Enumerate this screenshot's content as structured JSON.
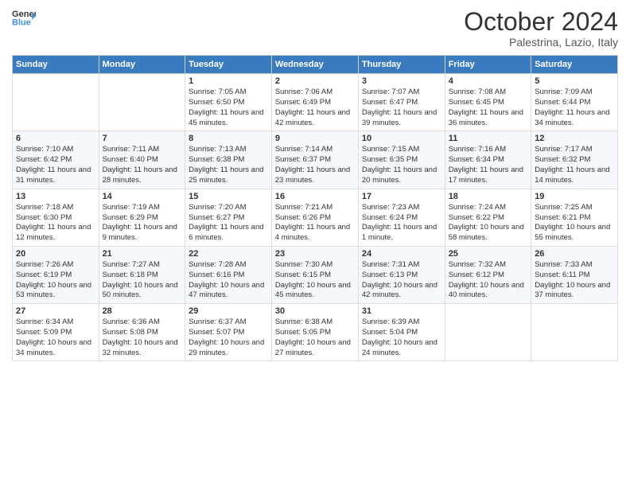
{
  "header": {
    "logo_line1": "General",
    "logo_line2": "Blue",
    "month": "October 2024",
    "location": "Palestrina, Lazio, Italy"
  },
  "weekdays": [
    "Sunday",
    "Monday",
    "Tuesday",
    "Wednesday",
    "Thursday",
    "Friday",
    "Saturday"
  ],
  "weeks": [
    [
      {
        "day": "",
        "sunrise": "",
        "sunset": "",
        "daylight": ""
      },
      {
        "day": "",
        "sunrise": "",
        "sunset": "",
        "daylight": ""
      },
      {
        "day": "1",
        "sunrise": "Sunrise: 7:05 AM",
        "sunset": "Sunset: 6:50 PM",
        "daylight": "Daylight: 11 hours and 45 minutes."
      },
      {
        "day": "2",
        "sunrise": "Sunrise: 7:06 AM",
        "sunset": "Sunset: 6:49 PM",
        "daylight": "Daylight: 11 hours and 42 minutes."
      },
      {
        "day": "3",
        "sunrise": "Sunrise: 7:07 AM",
        "sunset": "Sunset: 6:47 PM",
        "daylight": "Daylight: 11 hours and 39 minutes."
      },
      {
        "day": "4",
        "sunrise": "Sunrise: 7:08 AM",
        "sunset": "Sunset: 6:45 PM",
        "daylight": "Daylight: 11 hours and 36 minutes."
      },
      {
        "day": "5",
        "sunrise": "Sunrise: 7:09 AM",
        "sunset": "Sunset: 6:44 PM",
        "daylight": "Daylight: 11 hours and 34 minutes."
      }
    ],
    [
      {
        "day": "6",
        "sunrise": "Sunrise: 7:10 AM",
        "sunset": "Sunset: 6:42 PM",
        "daylight": "Daylight: 11 hours and 31 minutes."
      },
      {
        "day": "7",
        "sunrise": "Sunrise: 7:11 AM",
        "sunset": "Sunset: 6:40 PM",
        "daylight": "Daylight: 11 hours and 28 minutes."
      },
      {
        "day": "8",
        "sunrise": "Sunrise: 7:13 AM",
        "sunset": "Sunset: 6:38 PM",
        "daylight": "Daylight: 11 hours and 25 minutes."
      },
      {
        "day": "9",
        "sunrise": "Sunrise: 7:14 AM",
        "sunset": "Sunset: 6:37 PM",
        "daylight": "Daylight: 11 hours and 23 minutes."
      },
      {
        "day": "10",
        "sunrise": "Sunrise: 7:15 AM",
        "sunset": "Sunset: 6:35 PM",
        "daylight": "Daylight: 11 hours and 20 minutes."
      },
      {
        "day": "11",
        "sunrise": "Sunrise: 7:16 AM",
        "sunset": "Sunset: 6:34 PM",
        "daylight": "Daylight: 11 hours and 17 minutes."
      },
      {
        "day": "12",
        "sunrise": "Sunrise: 7:17 AM",
        "sunset": "Sunset: 6:32 PM",
        "daylight": "Daylight: 11 hours and 14 minutes."
      }
    ],
    [
      {
        "day": "13",
        "sunrise": "Sunrise: 7:18 AM",
        "sunset": "Sunset: 6:30 PM",
        "daylight": "Daylight: 11 hours and 12 minutes."
      },
      {
        "day": "14",
        "sunrise": "Sunrise: 7:19 AM",
        "sunset": "Sunset: 6:29 PM",
        "daylight": "Daylight: 11 hours and 9 minutes."
      },
      {
        "day": "15",
        "sunrise": "Sunrise: 7:20 AM",
        "sunset": "Sunset: 6:27 PM",
        "daylight": "Daylight: 11 hours and 6 minutes."
      },
      {
        "day": "16",
        "sunrise": "Sunrise: 7:21 AM",
        "sunset": "Sunset: 6:26 PM",
        "daylight": "Daylight: 11 hours and 4 minutes."
      },
      {
        "day": "17",
        "sunrise": "Sunrise: 7:23 AM",
        "sunset": "Sunset: 6:24 PM",
        "daylight": "Daylight: 11 hours and 1 minute."
      },
      {
        "day": "18",
        "sunrise": "Sunrise: 7:24 AM",
        "sunset": "Sunset: 6:22 PM",
        "daylight": "Daylight: 10 hours and 58 minutes."
      },
      {
        "day": "19",
        "sunrise": "Sunrise: 7:25 AM",
        "sunset": "Sunset: 6:21 PM",
        "daylight": "Daylight: 10 hours and 55 minutes."
      }
    ],
    [
      {
        "day": "20",
        "sunrise": "Sunrise: 7:26 AM",
        "sunset": "Sunset: 6:19 PM",
        "daylight": "Daylight: 10 hours and 53 minutes."
      },
      {
        "day": "21",
        "sunrise": "Sunrise: 7:27 AM",
        "sunset": "Sunset: 6:18 PM",
        "daylight": "Daylight: 10 hours and 50 minutes."
      },
      {
        "day": "22",
        "sunrise": "Sunrise: 7:28 AM",
        "sunset": "Sunset: 6:16 PM",
        "daylight": "Daylight: 10 hours and 47 minutes."
      },
      {
        "day": "23",
        "sunrise": "Sunrise: 7:30 AM",
        "sunset": "Sunset: 6:15 PM",
        "daylight": "Daylight: 10 hours and 45 minutes."
      },
      {
        "day": "24",
        "sunrise": "Sunrise: 7:31 AM",
        "sunset": "Sunset: 6:13 PM",
        "daylight": "Daylight: 10 hours and 42 minutes."
      },
      {
        "day": "25",
        "sunrise": "Sunrise: 7:32 AM",
        "sunset": "Sunset: 6:12 PM",
        "daylight": "Daylight: 10 hours and 40 minutes."
      },
      {
        "day": "26",
        "sunrise": "Sunrise: 7:33 AM",
        "sunset": "Sunset: 6:11 PM",
        "daylight": "Daylight: 10 hours and 37 minutes."
      }
    ],
    [
      {
        "day": "27",
        "sunrise": "Sunrise: 6:34 AM",
        "sunset": "Sunset: 5:09 PM",
        "daylight": "Daylight: 10 hours and 34 minutes."
      },
      {
        "day": "28",
        "sunrise": "Sunrise: 6:36 AM",
        "sunset": "Sunset: 5:08 PM",
        "daylight": "Daylight: 10 hours and 32 minutes."
      },
      {
        "day": "29",
        "sunrise": "Sunrise: 6:37 AM",
        "sunset": "Sunset: 5:07 PM",
        "daylight": "Daylight: 10 hours and 29 minutes."
      },
      {
        "day": "30",
        "sunrise": "Sunrise: 6:38 AM",
        "sunset": "Sunset: 5:05 PM",
        "daylight": "Daylight: 10 hours and 27 minutes."
      },
      {
        "day": "31",
        "sunrise": "Sunrise: 6:39 AM",
        "sunset": "Sunset: 5:04 PM",
        "daylight": "Daylight: 10 hours and 24 minutes."
      },
      {
        "day": "",
        "sunrise": "",
        "sunset": "",
        "daylight": ""
      },
      {
        "day": "",
        "sunrise": "",
        "sunset": "",
        "daylight": ""
      }
    ]
  ]
}
